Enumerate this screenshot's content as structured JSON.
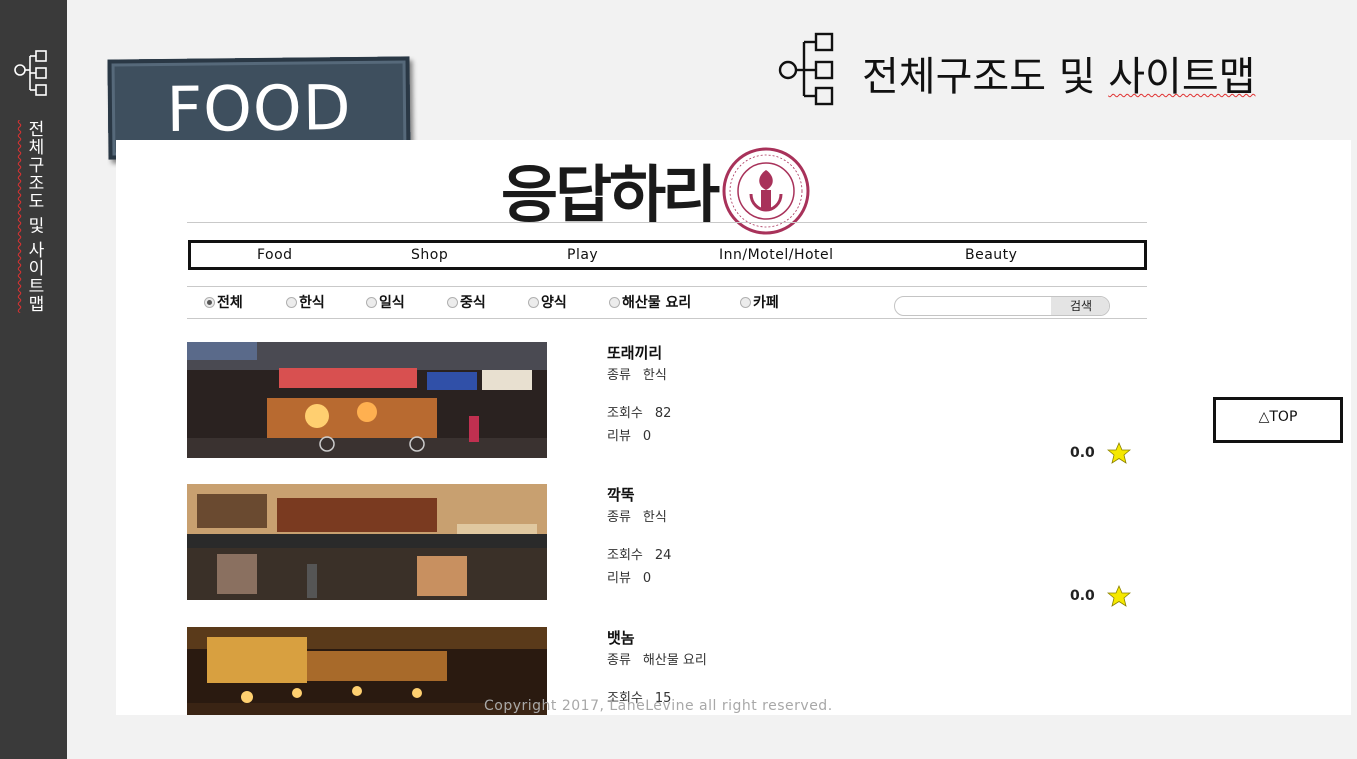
{
  "slide": {
    "banner_label": "FOOD",
    "title": "전체구조도 및 사이트맵",
    "sidebar_title": "전체구조도 및 사이트맵",
    "icon": "sitemap-icon"
  },
  "site": {
    "logo_text": "응답하라",
    "nav": [
      "Food",
      "Shop",
      "Play",
      "Inn/Motel/Hotel",
      "Beauty"
    ],
    "filters": [
      "전체",
      "한식",
      "일식",
      "중식",
      "양식",
      "해산물 요리",
      "카페"
    ],
    "selected_filter": "전체",
    "search": {
      "button_label": "검색",
      "value": ""
    },
    "labels": {
      "type": "종류",
      "views": "조회수",
      "reviews": "리뷰"
    },
    "items": [
      {
        "name": "또래끼리",
        "type": "한식",
        "views": "82",
        "reviews": "0",
        "rating": "0.0"
      },
      {
        "name": "깍뚝",
        "type": "한식",
        "views": "24",
        "reviews": "0",
        "rating": "0.0"
      },
      {
        "name": "뱃놈",
        "type": "해산물 요리",
        "views": "15"
      }
    ],
    "top_button": "△TOP",
    "copyright": "Copyright 2017, LaneLevine all right reserved.",
    "colors": {
      "accent_star": "#f5e800",
      "banner": "#3e4f5e",
      "sidebar": "#3a3a3a",
      "seal": "#a8325a"
    }
  }
}
